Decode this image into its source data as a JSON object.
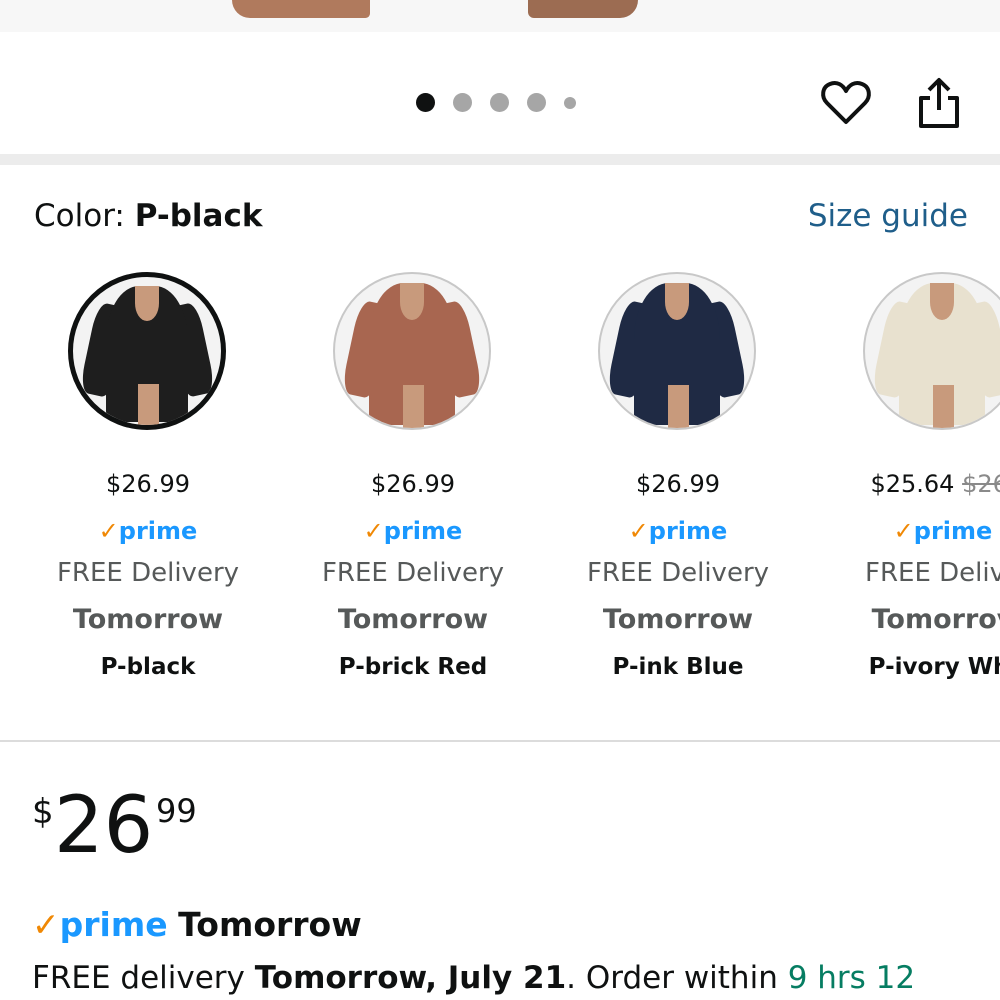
{
  "carousel": {
    "dot_count": 5,
    "active_index": 0
  },
  "color_section": {
    "label_prefix": "Color: ",
    "selected_color": "P-black",
    "size_guide": "Size guide"
  },
  "variants": [
    {
      "price": "$26.99",
      "strike": "",
      "prime": "prime",
      "delivery": "FREE Delivery",
      "when": "Tomorrow",
      "name": "P-black",
      "color": "#1e1e1e",
      "selected": true
    },
    {
      "price": "$26.99",
      "strike": "",
      "prime": "prime",
      "delivery": "FREE Delivery",
      "when": "Tomorrow",
      "name": "P-brick Red",
      "color": "#a86650",
      "selected": false
    },
    {
      "price": "$26.99",
      "strike": "",
      "prime": "prime",
      "delivery": "FREE Delivery",
      "when": "Tomorrow",
      "name": "P-ink Blue",
      "color": "#1f2a44",
      "selected": false
    },
    {
      "price": "$25.64",
      "strike": "$26.",
      "prime": "prime",
      "delivery": "FREE Delive",
      "when": "Tomorrov",
      "name": "P-ivory Whi",
      "color": "#e8e1cf",
      "selected": false
    }
  ],
  "price": {
    "currency": "$",
    "whole": "26",
    "fraction": "99"
  },
  "prime_delivery": {
    "prime": "prime",
    "speed": "Tomorrow"
  },
  "delivery": {
    "prefix": "FREE delivery ",
    "date": "Tomorrow, July 21",
    "middle": ". Order within ",
    "countdown": "9 hrs 12"
  },
  "colors": {
    "prime_blue": "#1a98ff",
    "prime_check": "#f08804",
    "link_blue": "#1f5e8a",
    "countdown_green": "#067d62"
  }
}
